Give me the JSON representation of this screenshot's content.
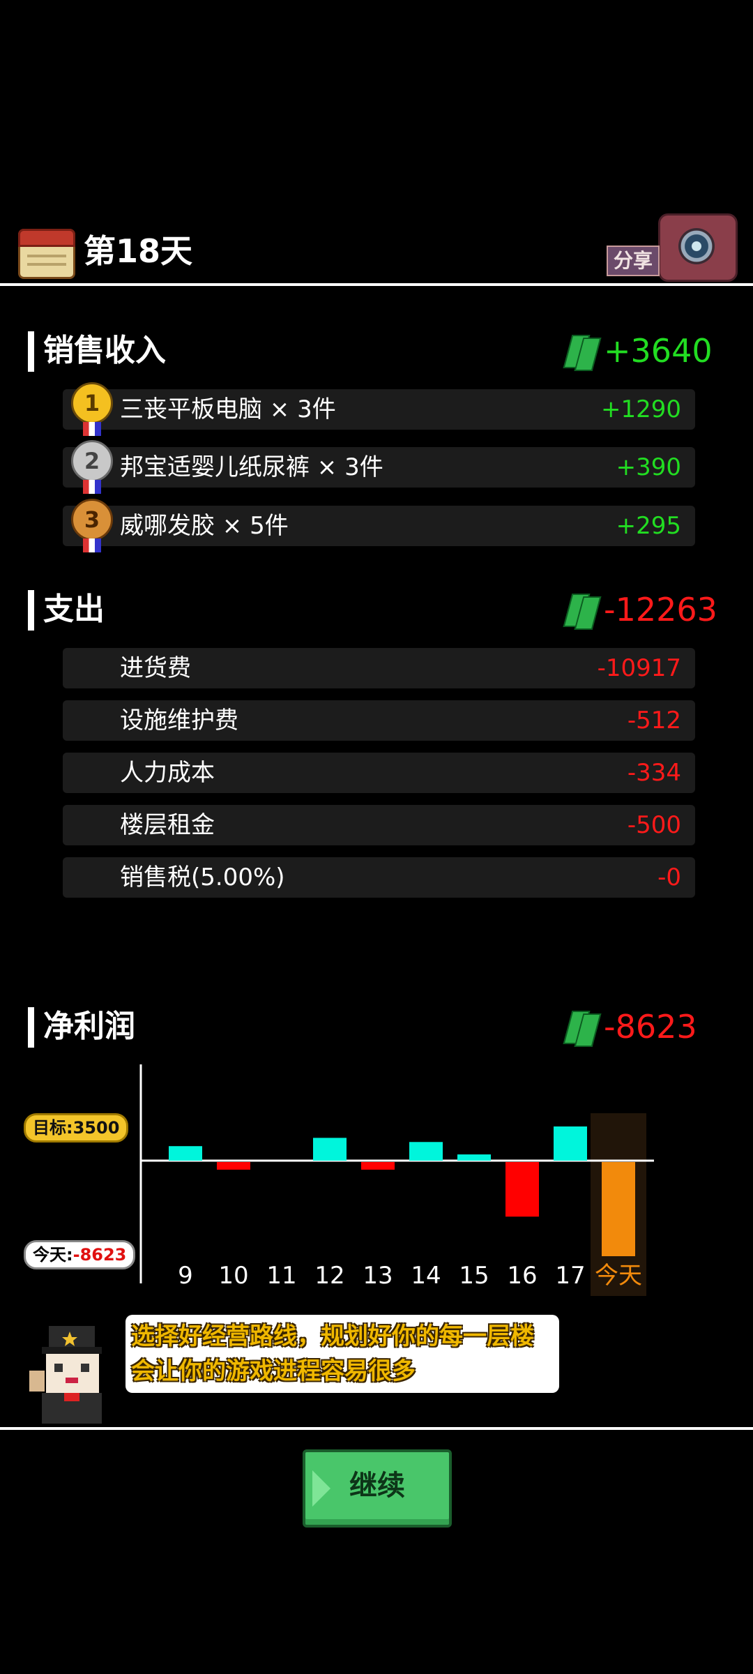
{
  "header": {
    "day_title": "第18天",
    "share_label": "分享"
  },
  "sales": {
    "title": "销售收入",
    "total": "+3640",
    "items": [
      {
        "rank": "1",
        "label": "三丧平板电脑 × 3件",
        "value": "+1290"
      },
      {
        "rank": "2",
        "label": "邦宝适婴儿纸尿裤 × 3件",
        "value": "+390"
      },
      {
        "rank": "3",
        "label": "威哪发胶 × 5件",
        "value": "+295"
      }
    ]
  },
  "expense": {
    "title": "支出",
    "total": "-12263",
    "items": [
      {
        "label": "进货费",
        "value": "-10917"
      },
      {
        "label": "设施维护费",
        "value": "-512"
      },
      {
        "label": "人力成本",
        "value": "-334"
      },
      {
        "label": "楼层租金",
        "value": "-500"
      },
      {
        "label": "销售税(5.00%)",
        "value": "-0"
      }
    ]
  },
  "profit": {
    "title": "净利润",
    "total": "-8623",
    "target_label": "目标:3500",
    "today_prefix": "今天:",
    "today_value": "-8623"
  },
  "chart_data": {
    "type": "bar",
    "categories": [
      "9",
      "10",
      "11",
      "12",
      "13",
      "14",
      "15",
      "16",
      "17",
      "今天"
    ],
    "values": [
      1400,
      -700,
      0,
      2200,
      -700,
      1800,
      600,
      -5000,
      3300,
      -8623
    ],
    "target": 3500,
    "colors": {
      "positive": "#00f5dc",
      "negative": "#ff0000",
      "today": "#f28a0c",
      "today_highlight": "#211509"
    }
  },
  "tip": {
    "text": "选择好经营路线，规划好你的每一层楼会让你的游戏进程容易很多"
  },
  "buttons": {
    "continue_label": "继续"
  }
}
